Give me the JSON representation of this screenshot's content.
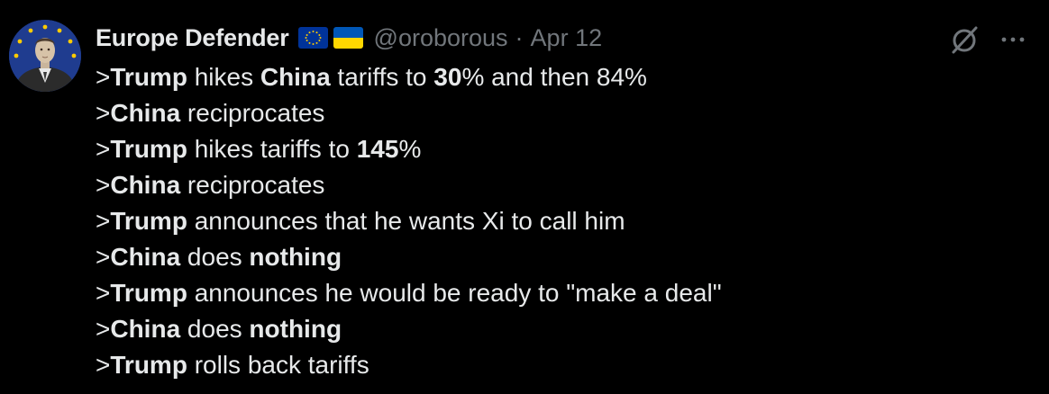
{
  "author": {
    "display_name": "Europe Defender",
    "handle": "@oroborous",
    "separator": "·",
    "date": "Apr 12",
    "flags": [
      "eu-flag-icon",
      "ukraine-flag-icon"
    ]
  },
  "icons": {
    "grok": "grok-icon",
    "more": "more-icon"
  },
  "colors": {
    "background": "#000000",
    "text": "#e7e9ea",
    "muted": "#71767b"
  },
  "tweet": {
    "lines": [
      {
        "t0": ">",
        "b0": "Trump",
        "t1": " hikes ",
        "b1": "China",
        "t2": " tariffs to ",
        "b2": "30",
        "t3": "% and then 84%"
      },
      {
        "t0": ">",
        "b0": "China",
        "t1": " reciprocates"
      },
      {
        "t0": ">",
        "b0": "Trump",
        "t1": " hikes tariffs to ",
        "b1": "145",
        "t2": "%"
      },
      {
        "t0": ">",
        "b0": "China",
        "t1": " reciprocates"
      },
      {
        "t0": ">",
        "b0": "Trump",
        "t1": " announces that he wants Xi to call him"
      },
      {
        "t0": ">",
        "b0": "China",
        "t1": " does ",
        "b1": "nothing"
      },
      {
        "t0": ">",
        "b0": "Trump",
        "t1": " announces he would be ready to \"make a deal\""
      },
      {
        "t0": ">",
        "b0": "China",
        "t1": " does ",
        "b1": "nothing"
      },
      {
        "t0": ">",
        "b0": "Trump",
        "t1": " rolls back tariffs"
      }
    ]
  }
}
